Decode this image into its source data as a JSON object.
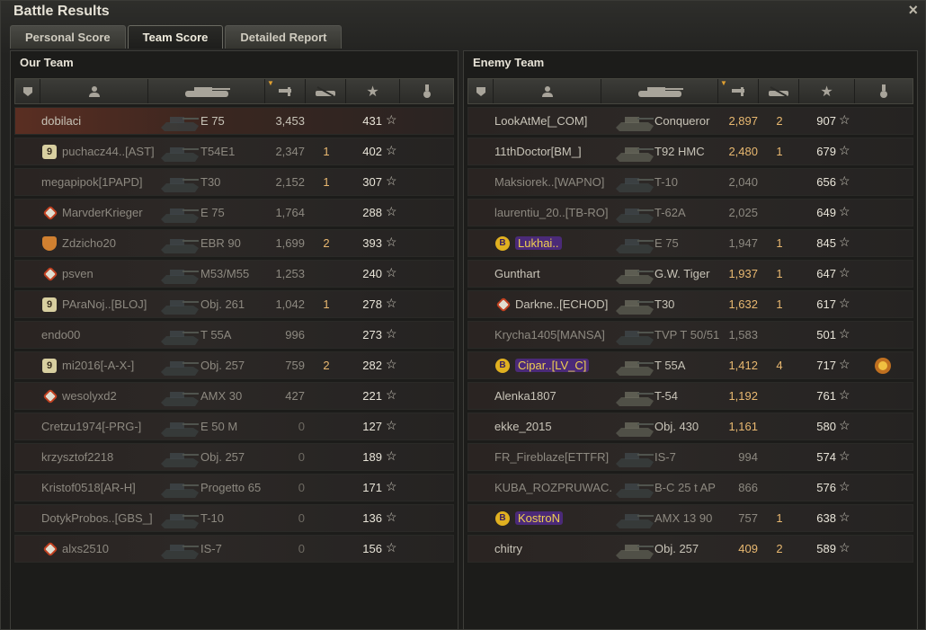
{
  "window": {
    "title": "Battle Results",
    "close_icon": "×"
  },
  "tabs": [
    {
      "label": "Personal Score",
      "active": false
    },
    {
      "label": "Team Score",
      "active": true
    },
    {
      "label": "Detailed Report",
      "active": false
    }
  ],
  "our_team": {
    "title": "Our Team",
    "rows": [
      {
        "name": "dobilaci",
        "clan": "",
        "vehicle": "E 75",
        "damage": "3,453",
        "frags": "",
        "xp": "431",
        "icon": "",
        "self": true,
        "dead": false
      },
      {
        "name": "puchacz44..",
        "clan": "[AST]",
        "vehicle": "T54E1",
        "damage": "2,347",
        "frags": "1",
        "xp": "402",
        "icon": "nine"
      },
      {
        "name": "megapipok",
        "clan": "[1PAPD]",
        "vehicle": "T30",
        "damage": "2,152",
        "frags": "1",
        "xp": "307",
        "icon": ""
      },
      {
        "name": "MarvderKrieger",
        "clan": "",
        "vehicle": "E 75",
        "damage": "1,764",
        "frags": "",
        "xp": "288",
        "icon": "diamond"
      },
      {
        "name": "Zdzicho20",
        "clan": "",
        "vehicle": "EBR 90",
        "damage": "1,699",
        "frags": "2",
        "xp": "393",
        "icon": "shield"
      },
      {
        "name": "psven",
        "clan": "",
        "vehicle": "M53/M55",
        "damage": "1,253",
        "frags": "",
        "xp": "240",
        "icon": "diamond"
      },
      {
        "name": "PAraNoj..",
        "clan": "[BLOJ]",
        "vehicle": "Obj. 261",
        "damage": "1,042",
        "frags": "1",
        "xp": "278",
        "icon": "nine"
      },
      {
        "name": "endo00",
        "clan": "",
        "vehicle": "T 55A",
        "damage": "996",
        "frags": "",
        "xp": "273",
        "icon": ""
      },
      {
        "name": "mi2016",
        "clan": "[-A-X-]",
        "vehicle": "Obj. 257",
        "damage": "759",
        "frags": "2",
        "xp": "282",
        "icon": "nine"
      },
      {
        "name": "wesolyxd2",
        "clan": "",
        "vehicle": "AMX 30",
        "damage": "427",
        "frags": "",
        "xp": "221",
        "icon": "diamond"
      },
      {
        "name": "Cretzu1974",
        "clan": "[-PRG-]",
        "vehicle": "E 50 M",
        "damage": "0",
        "frags": "",
        "xp": "127",
        "icon": ""
      },
      {
        "name": "krzysztof2218",
        "clan": "",
        "vehicle": "Obj. 257",
        "damage": "0",
        "frags": "",
        "xp": "189",
        "icon": ""
      },
      {
        "name": "Kristof0518",
        "clan": "[AR-H]",
        "vehicle": "Progetto 65",
        "damage": "0",
        "frags": "",
        "xp": "171",
        "icon": ""
      },
      {
        "name": "DotykProbos..",
        "clan": "[GBS_]",
        "vehicle": "T-10",
        "damage": "0",
        "frags": "",
        "xp": "136",
        "icon": ""
      },
      {
        "name": "alxs2510",
        "clan": "",
        "vehicle": "IS-7",
        "damage": "0",
        "frags": "",
        "xp": "156",
        "icon": "diamond"
      }
    ]
  },
  "enemy_team": {
    "title": "Enemy Team",
    "rows": [
      {
        "name": "LookAtMe",
        "clan": "[_COM]",
        "vehicle": "Conqueror",
        "damage": "2,897",
        "frags": "2",
        "xp": "907",
        "icon": "",
        "alive": true
      },
      {
        "name": "11thDoctor",
        "clan": "[BM_]",
        "vehicle": "T92 HMC",
        "damage": "2,480",
        "frags": "1",
        "xp": "679",
        "icon": "",
        "alive": true
      },
      {
        "name": "Maksiorek..",
        "clan": "[WAPNO]",
        "vehicle": "T-10",
        "damage": "2,040",
        "frags": "",
        "xp": "656",
        "icon": ""
      },
      {
        "name": "laurentiu_20..",
        "clan": "[TB-RO]",
        "vehicle": "T-62A",
        "damage": "2,025",
        "frags": "",
        "xp": "649",
        "icon": ""
      },
      {
        "name": "Lukhai..",
        "clan": "",
        "vehicle": "E 75",
        "damage": "1,947",
        "frags": "1",
        "xp": "845",
        "icon": "bbadge"
      },
      {
        "name": "Gunthart",
        "clan": "",
        "vehicle": "G.W. Tiger",
        "damage": "1,937",
        "frags": "1",
        "xp": "647",
        "icon": "",
        "alive": true
      },
      {
        "name": "Darkne..",
        "clan": "[ECHOD]",
        "vehicle": "T30",
        "damage": "1,632",
        "frags": "1",
        "xp": "617",
        "icon": "diamond",
        "alive": true
      },
      {
        "name": "Krycha1405",
        "clan": "[MANSA]",
        "vehicle": "TVP T 50/51",
        "damage": "1,583",
        "frags": "",
        "xp": "501",
        "icon": ""
      },
      {
        "name": "Cipar..",
        "clan": "[LV_C]",
        "vehicle": "T 55A",
        "damage": "1,412",
        "frags": "4",
        "xp": "717",
        "icon": "bbadge",
        "alive": true,
        "medal": true
      },
      {
        "name": "Alenka1807",
        "clan": "",
        "vehicle": "T-54",
        "damage": "1,192",
        "frags": "",
        "xp": "761",
        "icon": "",
        "alive": true
      },
      {
        "name": "ekke_2015",
        "clan": "",
        "vehicle": "Obj. 430",
        "damage": "1,161",
        "frags": "",
        "xp": "580",
        "icon": "",
        "alive": true
      },
      {
        "name": "FR_Fireblaze",
        "clan": "[ETTFR]",
        "vehicle": "IS-7",
        "damage": "994",
        "frags": "",
        "xp": "574",
        "icon": ""
      },
      {
        "name": "KUBA_ROZPRUWAC..",
        "clan": "",
        "vehicle": "B-C 25 t AP",
        "damage": "866",
        "frags": "",
        "xp": "576",
        "icon": ""
      },
      {
        "name": "KostroN",
        "clan": "",
        "vehicle": "AMX 13 90",
        "damage": "757",
        "frags": "1",
        "xp": "638",
        "icon": "bbadge"
      },
      {
        "name": "chitry",
        "clan": "",
        "vehicle": "Obj. 257",
        "damage": "409",
        "frags": "2",
        "xp": "589",
        "icon": "",
        "alive": true
      }
    ]
  },
  "columns": [
    "squad-icon",
    "player-icon",
    "tank-icon",
    "damage-icon",
    "frags-icon",
    "xp-star-icon",
    "medal-icon"
  ],
  "colors": {
    "highlight": "#e8b870",
    "self_row": "#5a2e22",
    "badge_purple": "#4b2a78",
    "badge_gold": "#e0b020"
  }
}
